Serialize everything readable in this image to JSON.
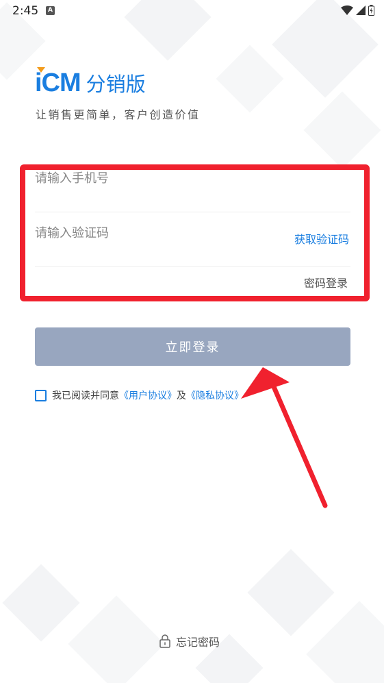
{
  "status_bar": {
    "time": "2:45",
    "notification_badge": "A"
  },
  "brand": {
    "logo_mark": "iCM",
    "product_name": "分销版",
    "slogan": "让销售更简单，客户创造价值"
  },
  "form": {
    "phone_placeholder": "请输入手机号",
    "code_placeholder": "请输入验证码",
    "get_code_label": "获取验证码",
    "password_login_label": "密码登录",
    "submit_label": "立即登录"
  },
  "agreement": {
    "prefix": "我已阅读并同意",
    "user_agreement": "《用户协议》",
    "conjunction": "及",
    "privacy_policy": "《隐私协议》"
  },
  "footer": {
    "forgot_password_label": "忘记密码"
  },
  "colors": {
    "accent": "#1a7ee0",
    "logo_triangle": "#f39c1d",
    "button_disabled": "#98a6bf",
    "annotation_red": "#f0212e"
  }
}
